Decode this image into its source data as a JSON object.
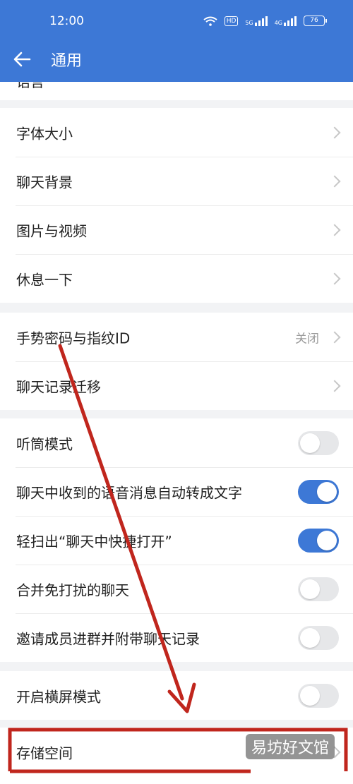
{
  "status_bar": {
    "time": "12:00",
    "hd": "HD",
    "net1": "5G",
    "net2": "4G",
    "battery": "76"
  },
  "header": {
    "title": "通用"
  },
  "section_top": {
    "partial": "语言"
  },
  "section1": [
    {
      "label": "字体大小"
    },
    {
      "label": "聊天背景"
    },
    {
      "label": "图片与视频"
    },
    {
      "label": "休息一下"
    }
  ],
  "section2": [
    {
      "label": "手势密码与指纹ID",
      "value": "关闭"
    },
    {
      "label": "聊天记录迁移"
    }
  ],
  "section3": [
    {
      "label": "听筒模式",
      "toggle": false
    },
    {
      "label": "聊天中收到的语音消息自动转成文字",
      "toggle": true
    },
    {
      "label": "轻扫出“聊天中快捷打开”",
      "toggle": true
    },
    {
      "label": "合并免打扰的聊天",
      "toggle": false
    },
    {
      "label": "邀请成员进群并附带聊天记录",
      "toggle": false
    }
  ],
  "section4": [
    {
      "label": "开启横屏模式",
      "toggle": false
    }
  ],
  "section5": [
    {
      "label": "存储空间"
    }
  ],
  "annotation_color": "#c0261d",
  "accent": "#3d78d6",
  "watermark": "易坊好文馆"
}
